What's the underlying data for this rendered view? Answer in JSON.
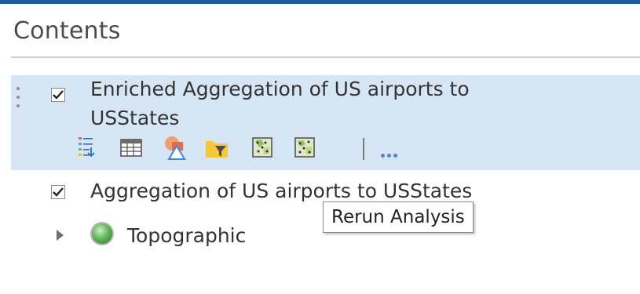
{
  "panel": {
    "title": "Contents"
  },
  "layers": [
    {
      "name": "Enriched Aggregation of US airports to",
      "name_cont": "USStates",
      "checked": true,
      "selected": true
    },
    {
      "name": "Aggregation of US airports to USStates",
      "checked": true,
      "selected": false
    },
    {
      "name": "Topographic",
      "checked": false,
      "selected": false
    }
  ],
  "toolbar": {
    "icons": [
      "show-legend-icon",
      "show-table-icon",
      "change-style-icon",
      "filter-icon",
      "perform-analysis-icon",
      "rerun-analysis-icon",
      "more-options-icon"
    ]
  },
  "tooltip": {
    "text": "Rerun Analysis"
  },
  "colors": {
    "accent": "#1f5a9c",
    "selection": "#d6e6f5",
    "more": "#4a87c8"
  }
}
